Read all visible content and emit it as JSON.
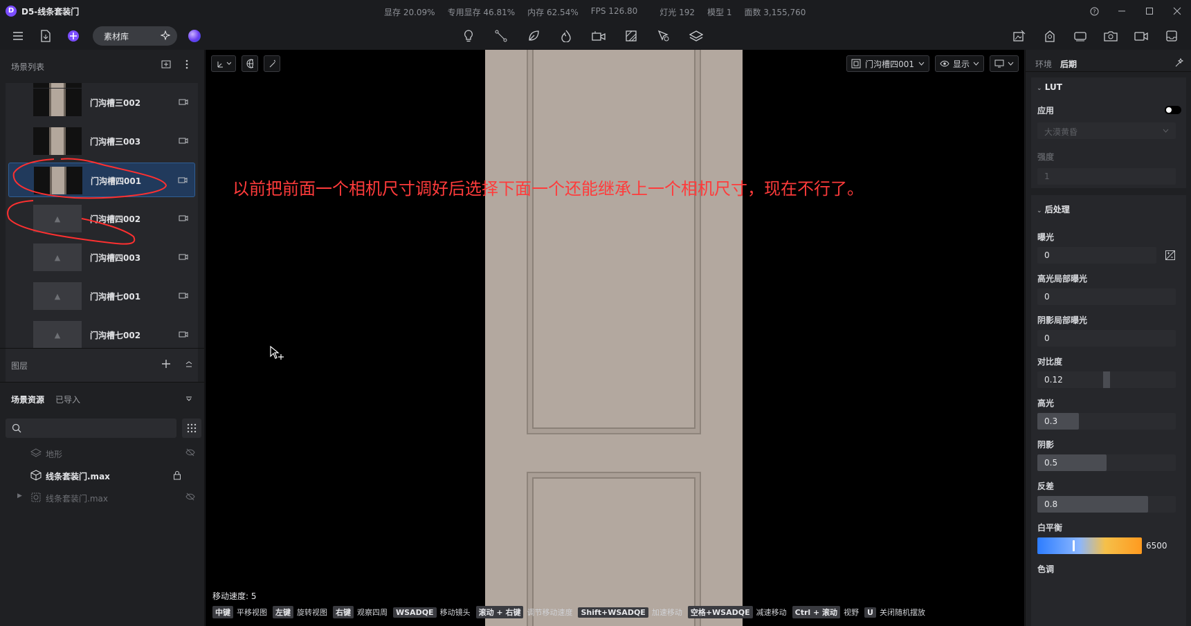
{
  "app": {
    "logo": "D",
    "title": "D5-线条套装门"
  },
  "stats": [
    "显存 20.09%",
    "专用显存 46.81%",
    "内存 62.54%",
    "FPS 126.80",
    "灯光 192",
    "模型 1",
    "面数 3,155,760"
  ],
  "toolbar": {
    "material_library": "素材库"
  },
  "left_panel": {
    "scene_list_title": "场景列表",
    "scene_items": [
      {
        "label": "门沟槽三002",
        "thumb": "door"
      },
      {
        "label": "门沟槽三003",
        "thumb": "door"
      },
      {
        "label": "门沟槽四001",
        "thumb": "door",
        "selected": true
      },
      {
        "label": "门沟槽四002",
        "thumb": "placeholder"
      },
      {
        "label": "门沟槽四003",
        "thumb": "placeholder"
      },
      {
        "label": "门沟槽七001",
        "thumb": "placeholder"
      },
      {
        "label": "门沟槽七002",
        "thumb": "placeholder"
      }
    ],
    "layers_title": "图层",
    "assets_tabs": [
      "场景资源",
      "已导入"
    ],
    "assets": [
      {
        "label": "地形",
        "dim": true
      },
      {
        "label": "线条套装门.max",
        "dim": false
      },
      {
        "label": "线条套装门.max",
        "dim": true
      }
    ]
  },
  "viewport": {
    "camera_select": "门沟槽四001",
    "display_label": "显示",
    "annotation": "以前把前面一个相机尺寸调好后选择下面一个还能继承上一个相机尺寸，现在不行了。",
    "move_speed": "移动速度: 5",
    "hints": [
      {
        "key": "中键",
        "text": "平移视图"
      },
      {
        "key": "左键",
        "text": "旋转视图"
      },
      {
        "key": "右键",
        "text": "观察四周"
      },
      {
        "key": "WSADQE",
        "text": "移动镜头"
      },
      {
        "key": "滚动 + 右键",
        "text": "调节移动速度"
      },
      {
        "key": "Shift+WSADQE",
        "text": "加速移动"
      },
      {
        "key": "空格+WSADQE",
        "text": "减速移动"
      },
      {
        "key": "Ctrl + 滚动",
        "text": "视野"
      },
      {
        "key": "U",
        "text": "关闭随机摆放"
      }
    ]
  },
  "right_panel": {
    "tabs": [
      "环境",
      "后期"
    ],
    "lut": {
      "title": "LUT",
      "apply_label": "应用",
      "apply_on": false,
      "preset": "大漠黄昏",
      "strength_label": "强度",
      "strength_value": "1"
    },
    "post": {
      "title": "后处理",
      "exposure_label": "曝光",
      "exposure_value": "0",
      "highlight_exposure_label": "高光局部曝光",
      "highlight_exposure_value": "0",
      "shadow_exposure_label": "阴影局部曝光",
      "shadow_exposure_value": "0",
      "contrast_label": "对比度",
      "contrast_value": "0.12",
      "contrast_level": 0.5,
      "highlights_label": "高光",
      "highlights_value": "0.3",
      "highlights_level": 0.3,
      "shadows_label": "阴影",
      "shadows_value": "0.5",
      "shadows_level": 0.5,
      "reflection_label": "反差",
      "reflection_value": "0.8",
      "reflection_level": 0.8,
      "wb_label": "白平衡",
      "wb_value": "6500",
      "wb_level": 0.35,
      "tint_label": "色调"
    }
  }
}
